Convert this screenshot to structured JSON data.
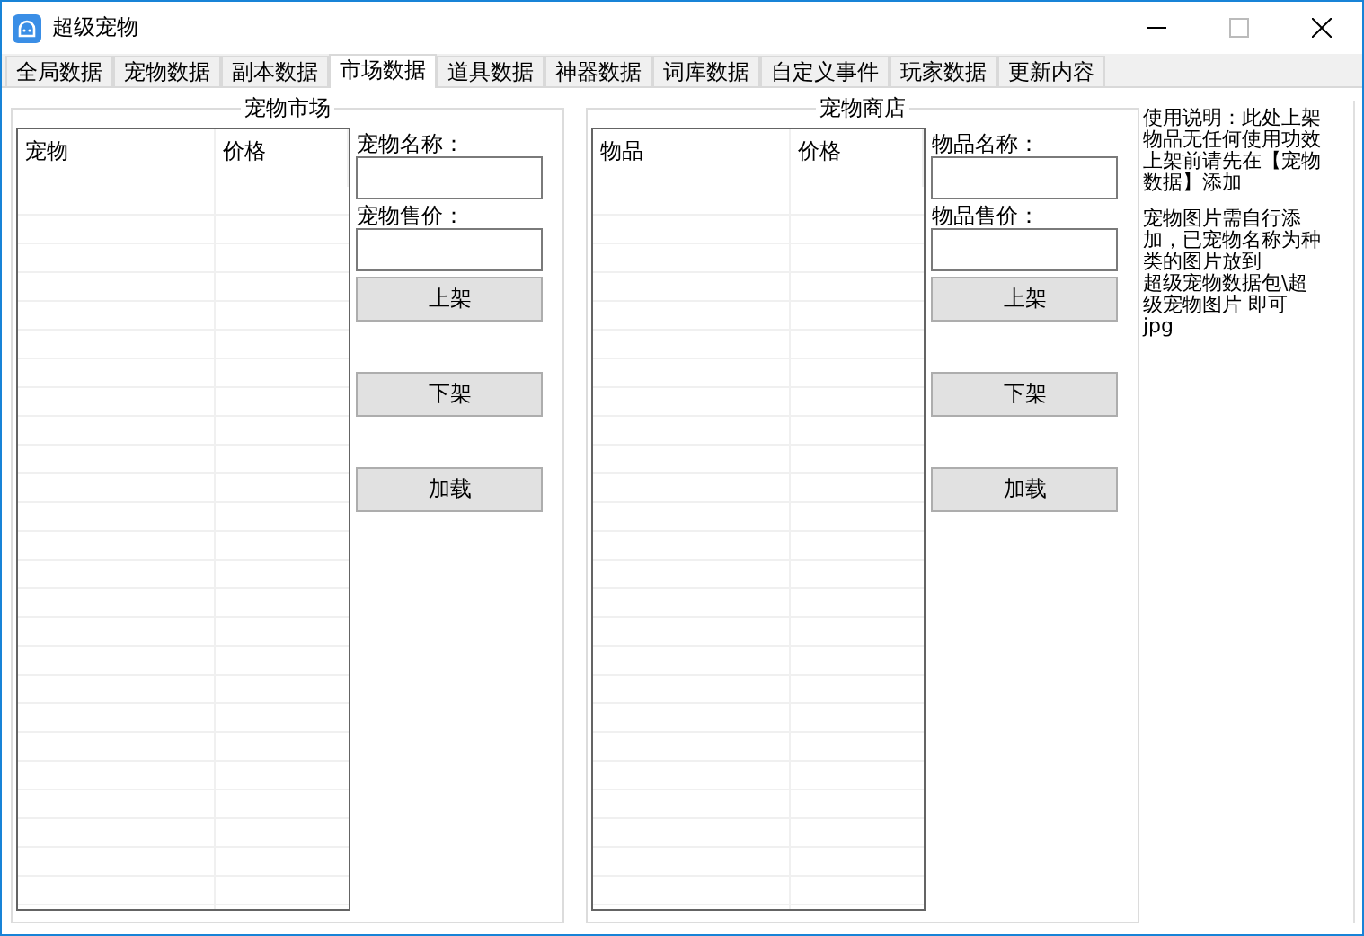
{
  "window": {
    "title": "超级宠物"
  },
  "tabs": [
    {
      "label": "全局数据",
      "selected": false
    },
    {
      "label": "宠物数据",
      "selected": false
    },
    {
      "label": "副本数据",
      "selected": false
    },
    {
      "label": "市场数据",
      "selected": true
    },
    {
      "label": "道具数据",
      "selected": false
    },
    {
      "label": "神器数据",
      "selected": false
    },
    {
      "label": "词库数据",
      "selected": false
    },
    {
      "label": "自定义事件",
      "selected": false
    },
    {
      "label": "玩家数据",
      "selected": false
    },
    {
      "label": "更新内容",
      "selected": false
    }
  ],
  "panels": [
    {
      "title": "宠物市场",
      "columns": [
        "宠物",
        "价格"
      ],
      "name_label": "宠物名称：",
      "price_label": "宠物售价：",
      "buttons": [
        "上架",
        "下架",
        "加载"
      ]
    },
    {
      "title": "宠物商店",
      "columns": [
        "物品",
        "价格"
      ],
      "name_label": "物品名称：",
      "price_label": "物品售价：",
      "buttons": [
        "上架",
        "下架",
        "加载"
      ]
    }
  ],
  "help": [
    {
      "lines": [
        "使用说明：此处上架",
        "物品无任何使用功效",
        "上架前请先在【宠物",
        "数据】添加"
      ]
    },
    {
      "lines": [
        "宠物图片需自行添",
        "加，已宠物名称为种",
        "类的图片放到",
        "超级宠物数据包\\超",
        "级宠物图片 即可",
        "jpg"
      ]
    }
  ]
}
